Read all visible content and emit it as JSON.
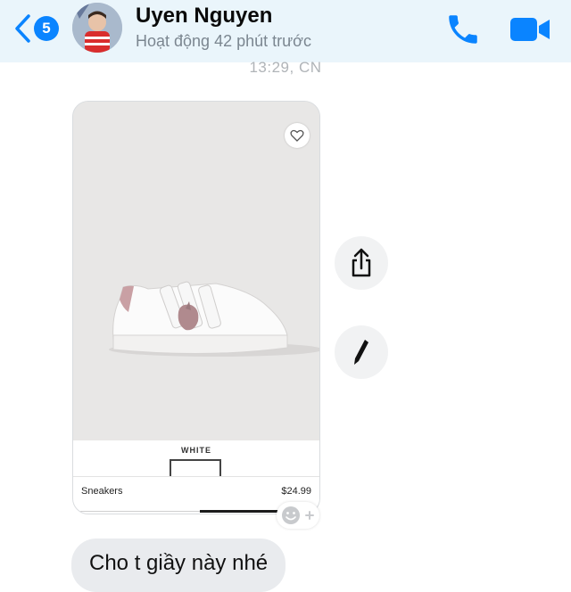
{
  "header": {
    "badge_count": "5",
    "contact_name": "Uyen Nguyen",
    "status": "Hoạt động 42 phút trước",
    "accent_color": "#0a84ff"
  },
  "timestamp": "13:29, CN",
  "product_card": {
    "color_label": "WHITE",
    "product_name": "Sneakers",
    "price": "$24.99"
  },
  "actions": {
    "share_icon": "share-icon",
    "edit_icon": "pencil-icon",
    "reaction_icon": "add-reaction-icon"
  },
  "message": {
    "text": "Cho t giầy này nhé"
  }
}
